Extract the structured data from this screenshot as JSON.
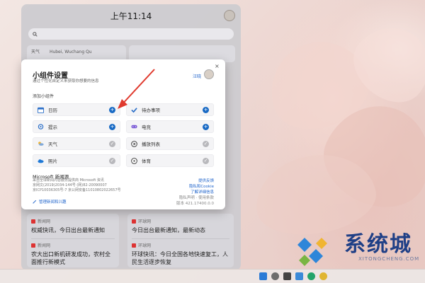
{
  "panel": {
    "time": "上午11:14",
    "mini_cards": [
      "天气",
      "Hubei, Wuchang Qu"
    ],
    "news": [
      {
        "source": "新闻网",
        "title": "权威快讯，今日出台最新通知"
      },
      {
        "source": "环球网",
        "title": "今日出台最新通知，最新动态"
      },
      {
        "source": "新闻网",
        "title": "农大出口新机研发成功，农村全面推行新模式"
      },
      {
        "source": "环球网",
        "title": "环球快讯：今日全国各地快速复工，人民生活逐步恢复"
      }
    ]
  },
  "dialog": {
    "title": "小组件设置",
    "subtitle": "通过个性化自定义来获取你想要的信息",
    "user_label": "汪晓",
    "close": "×",
    "section_label": "添加小组件",
    "widgets": [
      {
        "label": "日历",
        "icon": "calendar-icon",
        "state": "add"
      },
      {
        "label": "待办事项",
        "icon": "todo-check-icon",
        "state": "add"
      },
      {
        "label": "提示",
        "icon": "tips-bulb-icon",
        "state": "add"
      },
      {
        "label": "电竞",
        "icon": "gamepad-icon",
        "state": "add"
      },
      {
        "label": "天气",
        "icon": "weather-icon",
        "state": "added"
      },
      {
        "label": "播放列表",
        "icon": "playlist-icon",
        "state": "added"
      },
      {
        "label": "照片",
        "icon": "photos-cloud-icon",
        "state": "added"
      },
      {
        "label": "体育",
        "icon": "sports-icon",
        "state": "added"
      }
    ],
    "microsoft": {
      "title": "Microsoft 新闻源",
      "lines": [
        "来自全球新闻内容服务提供商 Microsoft 资讯",
        "京网文(2019)2034-144号 (网)82-20090007",
        "京ICP10036305号-7  京公网安备11010802022657号"
      ],
      "links": [
        "提供反馈",
        "隐私和Cookie",
        "了解详细信息"
      ],
      "version_lines": [
        "隐私声明 · 使用条款",
        "版本 421.17400.0.0"
      ],
      "manage_link": "管理新闻和兴趣"
    }
  },
  "watermark": {
    "text": "系统城",
    "sub": "XITONGCHENG.COM"
  },
  "colors": {
    "accent": "#1769c4",
    "arrow": "#e03a2e",
    "panel_bg": "#cccbd0",
    "watermark": "#1f3f86"
  }
}
